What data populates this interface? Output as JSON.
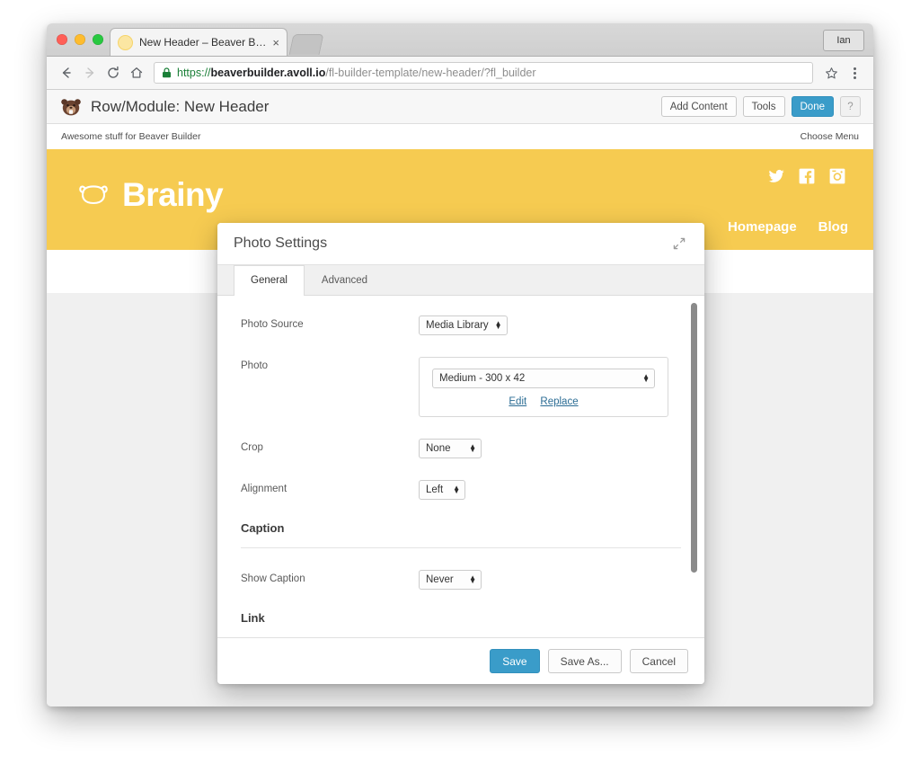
{
  "browser": {
    "tab": {
      "title": "New Header – Beaver Brains",
      "close_label": "×",
      "favicon": "beaver-favicon"
    },
    "new_tab_label": "",
    "profile_label": "Ian",
    "nav": {
      "back": "back-arrow-icon",
      "forward": "forward-arrow-icon",
      "reload": "reload-icon",
      "home": "home-icon"
    },
    "omnibox": {
      "lock": "lock-icon",
      "scheme": "https://",
      "host": "beaverbuilder.avoll.io",
      "path": "/fl-builder-template/new-header/?fl_builder",
      "star": "star-icon",
      "menu": "kebab-menu-icon"
    }
  },
  "builder_bar": {
    "logo": "beaver-builder-logo",
    "title": "Row/Module: New Header",
    "buttons": [
      {
        "label": "Add Content",
        "style": "default"
      },
      {
        "label": "Tools",
        "style": "default"
      },
      {
        "label": "Done",
        "style": "primary"
      }
    ],
    "help_label": "?"
  },
  "site": {
    "tagline": "Awesome stuff for Beaver Builder",
    "choose_menu": "Choose Menu",
    "brand_name": "Brainy",
    "brand_mark": "beaver-head-outline-icon",
    "social": [
      {
        "name": "twitter-icon"
      },
      {
        "name": "facebook-icon"
      },
      {
        "name": "instagram-icon"
      }
    ],
    "nav": [
      {
        "label": "Homepage"
      },
      {
        "label": "Blog"
      }
    ],
    "hero_color": "#f6cb51"
  },
  "modal": {
    "title": "Photo Settings",
    "expand_icon": "expand-diagonal-icon",
    "tabs": [
      {
        "label": "General",
        "active": true
      },
      {
        "label": "Advanced",
        "active": false
      }
    ],
    "fields": [
      {
        "label": "Photo Source",
        "value": "Media Library"
      },
      {
        "label": "Crop",
        "value": "None"
      },
      {
        "label": "Alignment",
        "value": "Left"
      },
      {
        "label": "Show Caption",
        "value": "Never"
      }
    ],
    "photo_field": {
      "label": "Photo",
      "size_value": "Medium - 300 x 42",
      "edit_label": "Edit",
      "replace_label": "Replace"
    },
    "sections": [
      {
        "label": "Caption"
      },
      {
        "label": "Link"
      }
    ],
    "footer_buttons": [
      {
        "label": "Save",
        "style": "primary"
      },
      {
        "label": "Save As...",
        "style": "default"
      },
      {
        "label": "Cancel",
        "style": "default"
      }
    ],
    "accent_color": "#3a9cc9"
  }
}
